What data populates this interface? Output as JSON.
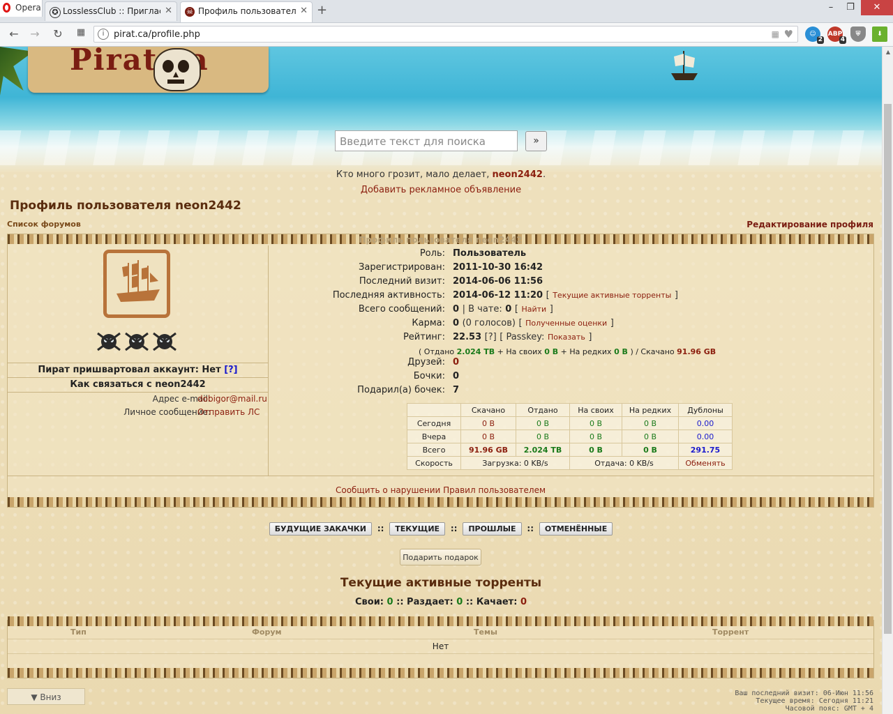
{
  "browser": {
    "menu_label": "Opera",
    "tabs": [
      {
        "title": "LosslessClub :: Приглаcит",
        "active": false
      },
      {
        "title": "Профиль пользователя n",
        "active": true
      }
    ],
    "url": "pirat.ca/profile.php",
    "extensions": [
      {
        "name": "ext-face-icon",
        "badge": "2",
        "color": "#2a8fd6"
      },
      {
        "name": "adblock-icon",
        "label": "ABP",
        "badge": "4",
        "color": "#c0392b"
      },
      {
        "name": "shield-icon",
        "badge": "",
        "color": "#888888"
      },
      {
        "name": "download-arrow-icon",
        "badge": "",
        "color": "#6ab12e"
      }
    ]
  },
  "header": {
    "logo_text": "Pirat ca",
    "search_placeholder": "Введите текст для поиска",
    "search_button": "»"
  },
  "quote": {
    "text": "Кто много грозит, мало делает,",
    "username": "neon2442",
    "period": "."
  },
  "ad_link": "Добавить рекламное объявление",
  "page_title": "Профиль пользователя neon2442",
  "forum_list_link": "Список форумов",
  "edit_profile_link": "Редактирование профиля",
  "panel_header": "Профиль пользователя neon2442",
  "left": {
    "moored_label": "Пират пришвартовал аккаунт: Нет",
    "moored_help": "[?]",
    "contact_title": "Как связаться с neon2442",
    "email_label": "Адрес e-mail:",
    "email_value": "dobigor@mail.ru",
    "pm_label": "Личное сообщение:",
    "pm_value": "Отправить ЛС"
  },
  "info": {
    "role_label": "Роль:",
    "role": "Пользователь",
    "registered_label": "Зарегистрирован:",
    "registered": "2011-10-30 16:42",
    "last_visit_label": "Последний визит:",
    "last_visit": "2014-06-06 11:56",
    "last_activity_label": "Последняя активность:",
    "last_activity": "2014-06-12 11:20",
    "active_torrents_link": "Текущие активные торренты",
    "posts_label": "Всего сообщений:",
    "posts": "0",
    "chat_label": "| В чате:",
    "chat": "0",
    "find_link": "Найти",
    "karma_label": "Карма:",
    "karma": "0",
    "karma_votes": "(0 голосов)",
    "karma_link": "Полученные оценки",
    "rating_label": "Рейтинг:",
    "rating": "22.53",
    "rating_help": "[?]",
    "passkey_label": "[ Passkey:",
    "passkey_link": "Показать",
    "ratio": {
      "given_label": "( Отдано",
      "given": "2.024 TB",
      "own_label": "+ На своих",
      "own": "0 B",
      "rare_label": "+ На редких",
      "rare": "0 B",
      "downloaded_label": ") / Скачано",
      "downloaded": "91.96 GB"
    },
    "friends_label": "Друзей:",
    "friends": "0",
    "barrels_label": "Бочки:",
    "barrels": "0",
    "gifted_label": "Подарил(а) бочек:",
    "gifted": "7"
  },
  "stats_table": {
    "headers": [
      "",
      "Скачано",
      "Отдано",
      "На своих",
      "На редких",
      "Дублоны"
    ],
    "rows": [
      [
        "Сегодня",
        "0 B",
        "0 B",
        "0 B",
        "0 B",
        "0.00"
      ],
      [
        "Вчера",
        "0 B",
        "0 B",
        "0 B",
        "0 B",
        "0.00"
      ],
      [
        "Всего",
        "91.96 GB",
        "2.024 TB",
        "0 B",
        "0 B",
        "291.75"
      ]
    ],
    "speed_label": "Скорость",
    "download_speed": "Загрузка: 0 KB/s",
    "upload_speed": "Отдача: 0 KB/s",
    "exchange_link": "Обменять"
  },
  "report_link": "Сообщить о нарушении Правил пользователем",
  "torrent_buttons": [
    "БУДУЩИЕ ЗАКАЧКИ",
    "ТЕКУЩИЕ",
    "ПРОШЛЫЕ",
    "ОТМЕНЁННЫЕ"
  ],
  "separator": "::",
  "gift_button": "Подарить подарок",
  "torrents": {
    "title": "Текущие активные торренты",
    "own_label": "Свои:",
    "own": "0",
    "seeding_label": ":: Раздает:",
    "seeding": "0",
    "leeching_label": ":: Качает:",
    "leeching": "0",
    "columns": [
      "Тип",
      "Форум",
      "Темы",
      "Торрент"
    ],
    "empty": "Нет"
  },
  "down_button": "▼ Вниз",
  "footer": {
    "last_visit": "Ваш последний визит: 06-Июн 11:56",
    "current_time": "Текущее время: Сегодня 11:21",
    "timezone": "Часовой пояс: GMT + 4"
  }
}
